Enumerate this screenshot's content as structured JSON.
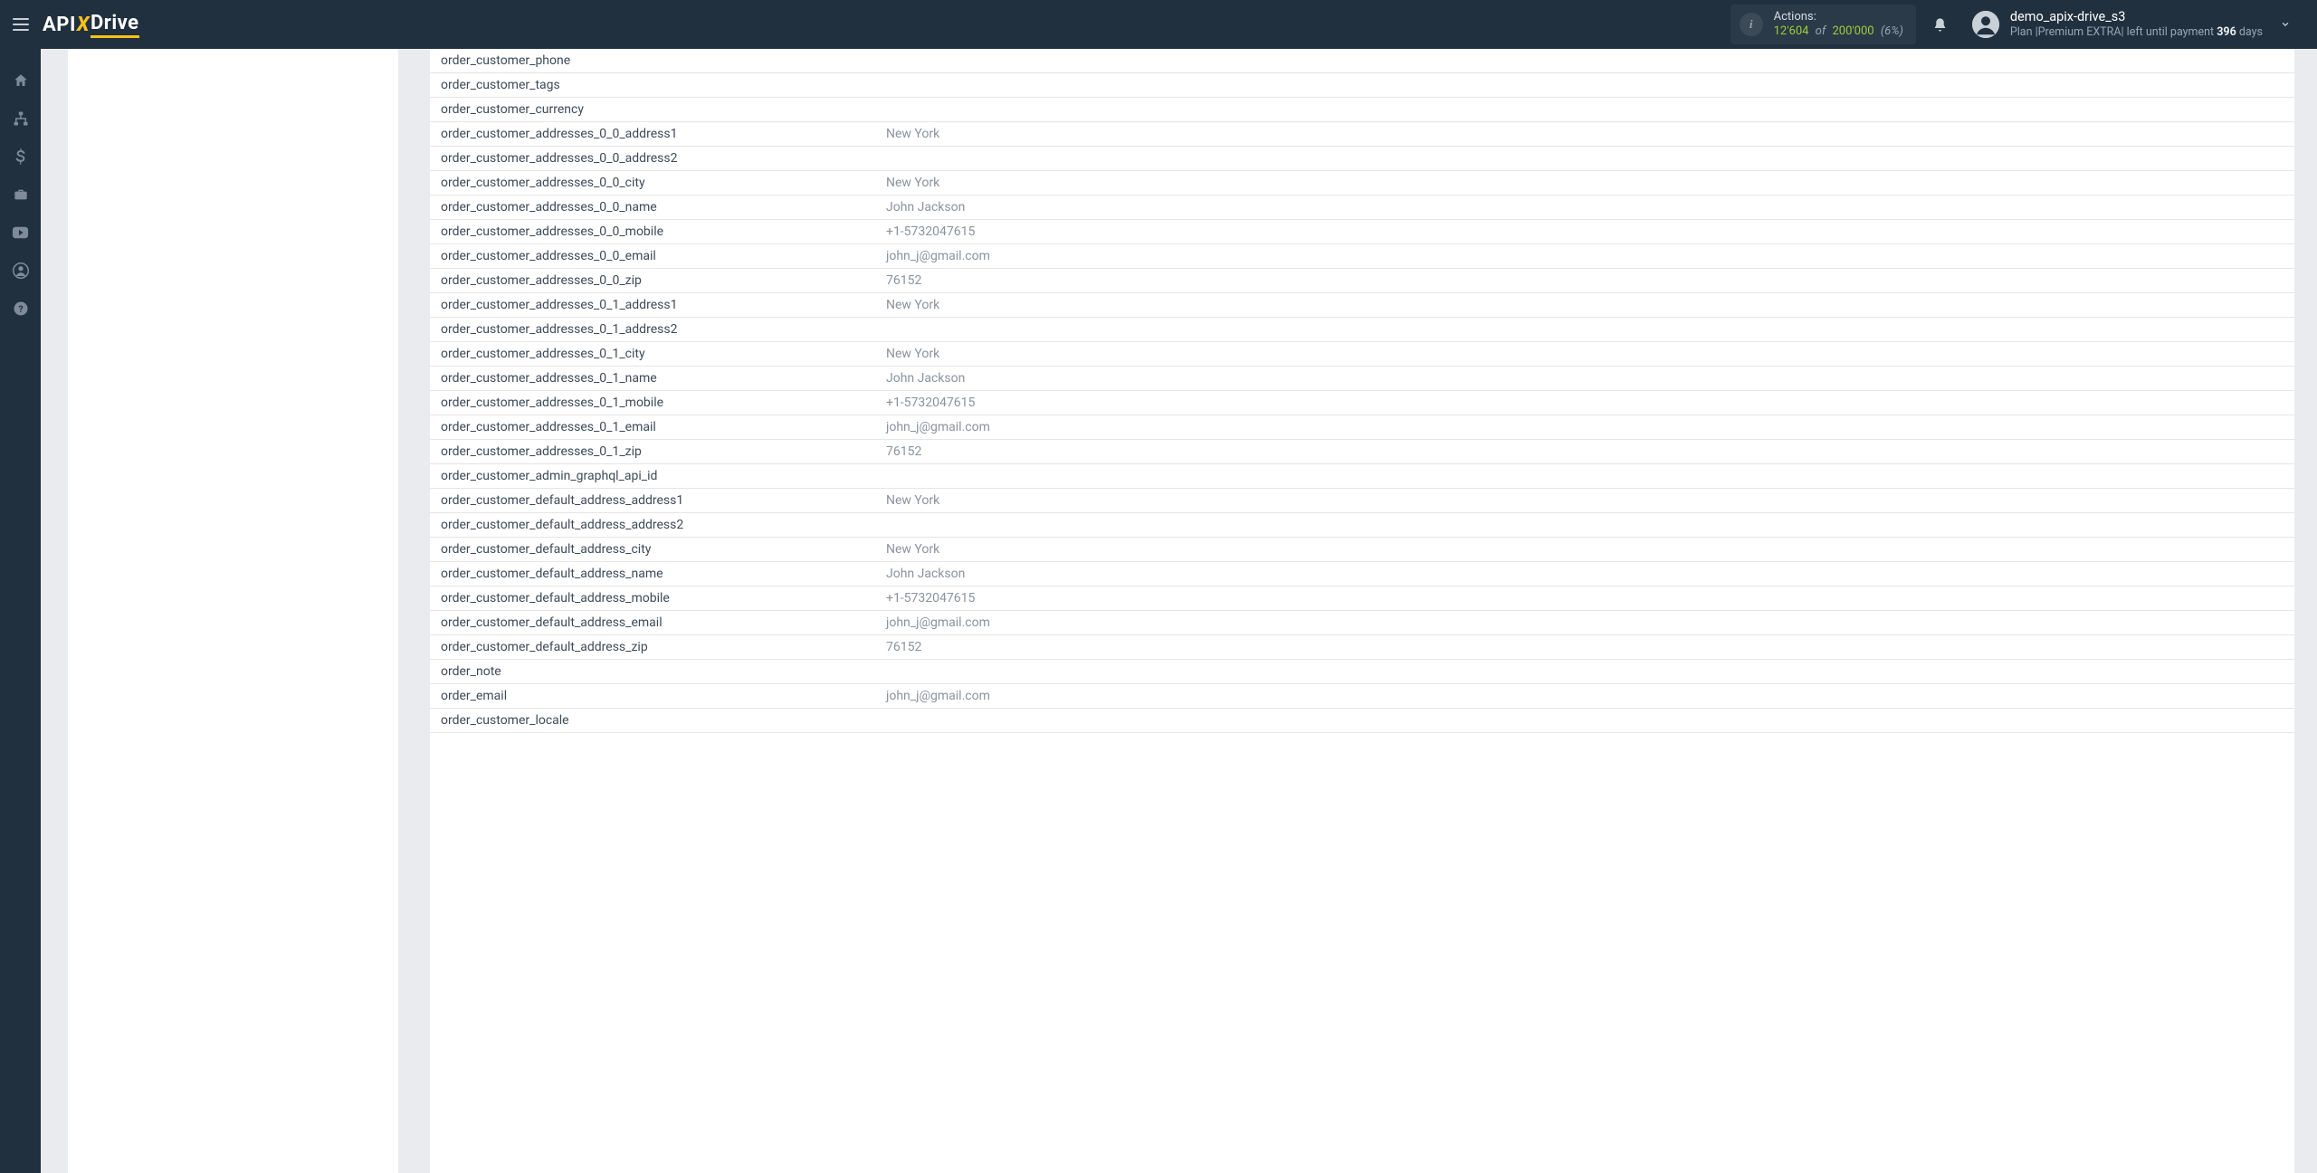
{
  "header": {
    "logo_api": "API",
    "logo_x": "X",
    "logo_drive": "Drive",
    "actions_label": "Actions:",
    "actions_used": "12'604",
    "actions_of": "of",
    "actions_total": "200'000",
    "actions_pct": "(6%)",
    "user_name": "demo_apix-drive_s3",
    "plan_prefix": "Plan |",
    "plan_name": "Premium EXTRA",
    "plan_mid": "| left until payment ",
    "plan_days_num": "396",
    "plan_days_suffix": " days"
  },
  "sidebar_icons": [
    "home-icon",
    "sitemap-icon",
    "dollar-icon",
    "briefcase-icon",
    "youtube-icon",
    "user-icon",
    "help-icon"
  ],
  "rows": [
    {
      "key": "order_customer_phone",
      "val": ""
    },
    {
      "key": "order_customer_tags",
      "val": ""
    },
    {
      "key": "order_customer_currency",
      "val": ""
    },
    {
      "key": "order_customer_addresses_0_0_address1",
      "val": "New York"
    },
    {
      "key": "order_customer_addresses_0_0_address2",
      "val": ""
    },
    {
      "key": "order_customer_addresses_0_0_city",
      "val": "New York"
    },
    {
      "key": "order_customer_addresses_0_0_name",
      "val": "John Jackson"
    },
    {
      "key": "order_customer_addresses_0_0_mobile",
      "val": "+1-5732047615"
    },
    {
      "key": "order_customer_addresses_0_0_email",
      "val": "john_j@gmail.com"
    },
    {
      "key": "order_customer_addresses_0_0_zip",
      "val": "76152"
    },
    {
      "key": "order_customer_addresses_0_1_address1",
      "val": "New York"
    },
    {
      "key": "order_customer_addresses_0_1_address2",
      "val": ""
    },
    {
      "key": "order_customer_addresses_0_1_city",
      "val": "New York"
    },
    {
      "key": "order_customer_addresses_0_1_name",
      "val": "John Jackson"
    },
    {
      "key": "order_customer_addresses_0_1_mobile",
      "val": "+1-5732047615"
    },
    {
      "key": "order_customer_addresses_0_1_email",
      "val": "john_j@gmail.com"
    },
    {
      "key": "order_customer_addresses_0_1_zip",
      "val": "76152"
    },
    {
      "key": "order_customer_admin_graphql_api_id",
      "val": ""
    },
    {
      "key": "order_customer_default_address_address1",
      "val": "New York"
    },
    {
      "key": "order_customer_default_address_address2",
      "val": ""
    },
    {
      "key": "order_customer_default_address_city",
      "val": "New York"
    },
    {
      "key": "order_customer_default_address_name",
      "val": "John Jackson"
    },
    {
      "key": "order_customer_default_address_mobile",
      "val": "+1-5732047615"
    },
    {
      "key": "order_customer_default_address_email",
      "val": "john_j@gmail.com"
    },
    {
      "key": "order_customer_default_address_zip",
      "val": "76152"
    },
    {
      "key": "order_note",
      "val": ""
    },
    {
      "key": "order_email",
      "val": "john_j@gmail.com"
    },
    {
      "key": "order_customer_locale",
      "val": ""
    }
  ]
}
